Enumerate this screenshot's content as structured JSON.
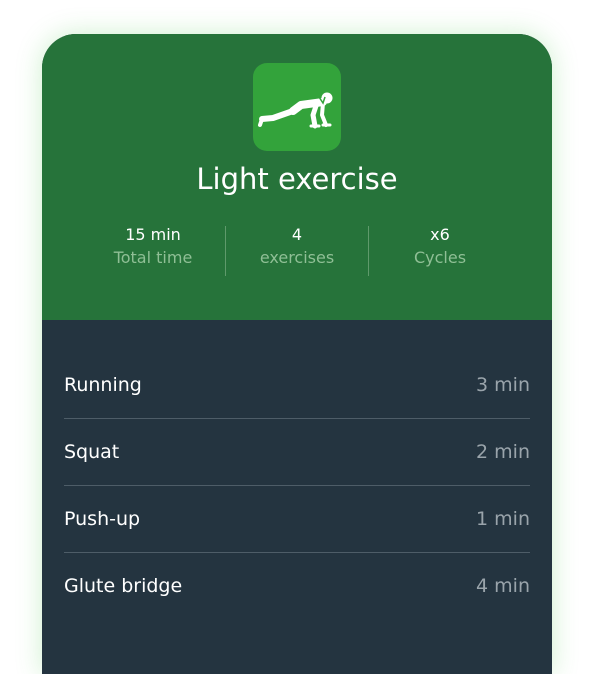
{
  "workout": {
    "title": "Light exercise",
    "icon": "push-up-icon",
    "colors": {
      "header_bg": "#26733a",
      "icon_bg": "#33a33b",
      "list_bg": "#243440"
    },
    "stats": [
      {
        "value": "15 min",
        "label": "Total time"
      },
      {
        "value": "4",
        "label": "exercises"
      },
      {
        "value": "x6",
        "label": "Cycles"
      }
    ]
  },
  "exercises": [
    {
      "name": "Running",
      "duration": "3 min"
    },
    {
      "name": "Squat",
      "duration": "2 min"
    },
    {
      "name": "Push-up",
      "duration": "1 min"
    },
    {
      "name": "Glute bridge",
      "duration": "4 min"
    }
  ]
}
